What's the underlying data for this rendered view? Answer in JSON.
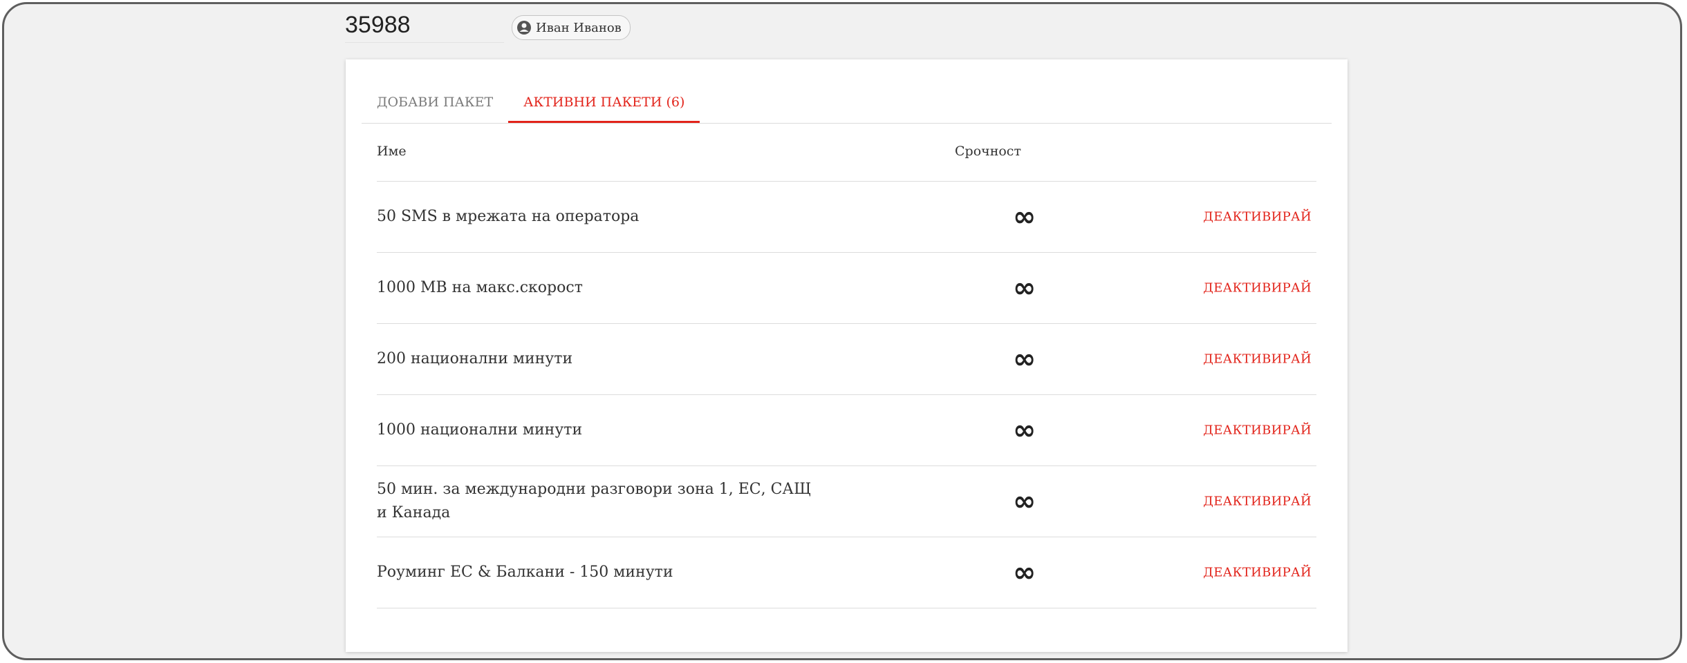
{
  "header": {
    "phone_number": "35988",
    "user_name": "Иван Иванов",
    "user_icon": "user-circle-icon"
  },
  "tabs": [
    {
      "label": "ДОБАВИ ПАКЕТ",
      "active": false
    },
    {
      "label": "АКТИВНИ ПАКЕТИ (6)",
      "active": true
    }
  ],
  "table": {
    "columns": {
      "name": "Име",
      "term": "Срочност"
    },
    "rows": [
      {
        "name": "50 SMS в мрежата на оператора",
        "term": "∞",
        "action": "ДЕАКТИВИРАЙ"
      },
      {
        "name": "1000 MB на макс.скорост",
        "term": "∞",
        "action": "ДЕАКТИВИРАЙ"
      },
      {
        "name": "200 национални минути",
        "term": "∞",
        "action": "ДЕАКТИВИРАЙ"
      },
      {
        "name": "1000 национални минути",
        "term": "∞",
        "action": "ДЕАКТИВИРАЙ"
      },
      {
        "name": "50 мин. за международни разговори зона 1, ЕС, САЩ и Канада",
        "term": "∞",
        "action": "ДЕАКТИВИРАЙ"
      },
      {
        "name": "Роуминг ЕС & Балкани - 150 минути",
        "term": "∞",
        "action": "ДЕАКТИВИРАЙ"
      }
    ]
  },
  "colors": {
    "accent": "#e2231a",
    "background": "#f1f1f1",
    "card": "#ffffff",
    "text": "#333333",
    "divider": "#dcdcdc"
  }
}
